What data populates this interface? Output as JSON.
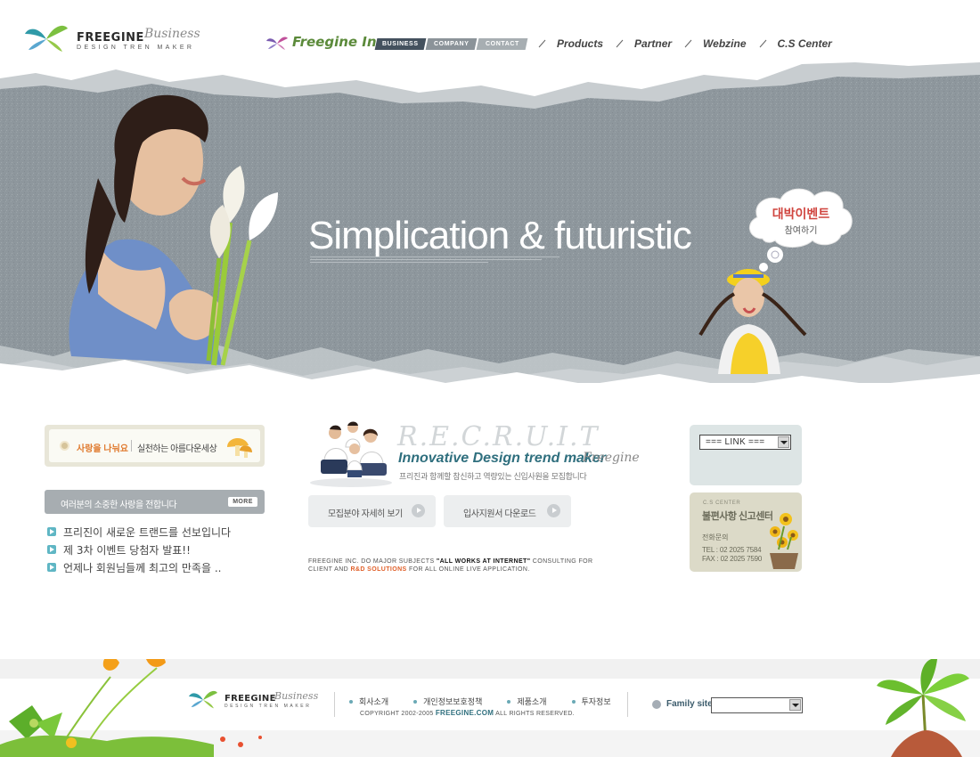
{
  "header": {
    "logo_main": "FREEGINE",
    "logo_script": "Business",
    "logo_tag": "DESIGN TREN MAKER",
    "brand_name": "Freegine Inc",
    "tab_buttons": [
      "BUSINESS",
      "COMPANY",
      "CONTACT"
    ],
    "nav": [
      "Products",
      "Partner",
      "Webzine",
      "C.S Center"
    ]
  },
  "hero": {
    "title_main": "Simplication",
    "title_rest": " & futuristic",
    "event_title": "대박이벤트",
    "event_sub": "참여하기"
  },
  "promo": {
    "text_a": "사랑을 나눠요",
    "text_b": "실천하는 아름다운세상"
  },
  "notice": {
    "title": "여러분의 소중한 사랑을 전합니다",
    "more_label": "MORE",
    "items": [
      "프리진이 새로운 트랜드를 선보입니다",
      "제 3차 이벤트 당첨자 발표!!",
      "언제나 회원님들께 최고의 만족을 .."
    ]
  },
  "recruit": {
    "big": "R.E.C.R.U.I.T",
    "tagline": "Innovative Design trend maker",
    "script": "Freegine",
    "desc": "프리진과 함께할 참신하고 역량있는 신입사원을 모집합니다",
    "btn1": "모집분야 자세히 보기",
    "btn2": "입사지원서 다운로드"
  },
  "copy_note": {
    "line1_a": "FREEGINE INC. DO MAJOR SUBJECTS ",
    "line1_b": "\"ALL WORKS AT INTERNET\"",
    "line1_c": " CONSULTING FOR",
    "line2_a": "CLIENT AND ",
    "line2_b": "R&D SOLUTIONS",
    "line2_c": " FOR ALL ONLINE LIVE APPLICATION."
  },
  "link_box": {
    "select_value": "=== LINK ==="
  },
  "cs_center": {
    "label": "C.S CENTER",
    "title": "불편사항 신고센터",
    "phone_label": "전화문의",
    "tel": "TEL : 02 2025 7584",
    "fax": "FAX : 02 2025 7590"
  },
  "footer": {
    "logo_main": "FREEGINE",
    "logo_script": "Business",
    "logo_tag": "DESIGN TREN MAKER",
    "links": [
      "회사소개",
      "개인정보보호정책",
      "제품소개",
      "투자정보"
    ],
    "copy_a": "COPYRIGHT 2002-2005 ",
    "copy_site": "FREEGINE.com",
    "copy_b": " ALL RIGHTS RESERVED.",
    "family_label": "Family site",
    "family_value": ""
  },
  "colors": {
    "accent_teal": "#2f6f7e",
    "hero_gray": "#8e979d",
    "event_red": "#d0453f",
    "bullet_teal": "#5fb6c4"
  }
}
